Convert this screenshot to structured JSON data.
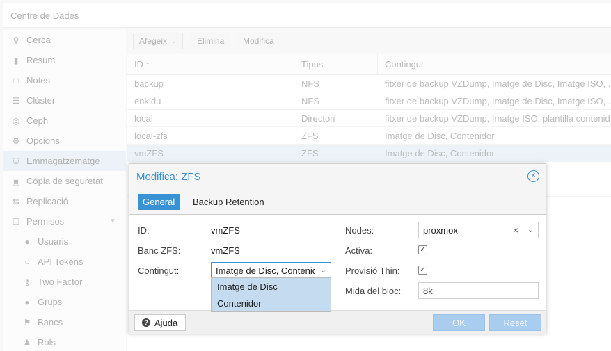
{
  "topbar": {
    "title": "Centre de Dades"
  },
  "sidebar": {
    "items": [
      {
        "label": "Cerca",
        "icon": "search-icon"
      },
      {
        "label": "Resum",
        "icon": "book-icon"
      },
      {
        "label": "Notes",
        "icon": "note-icon"
      },
      {
        "label": "Clúster",
        "icon": "server-icon"
      },
      {
        "label": "Ceph",
        "icon": "ceph-icon"
      },
      {
        "label": "Opcions",
        "icon": "gear-icon"
      },
      {
        "label": "Emmagatzematge",
        "icon": "database-icon"
      },
      {
        "label": "Còpia de seguretat",
        "icon": "floppy-icon"
      },
      {
        "label": "Replicació",
        "icon": "retweet-icon"
      },
      {
        "label": "Permisos",
        "icon": "unlock-icon"
      },
      {
        "label": "Usuaris",
        "icon": "user-icon"
      },
      {
        "label": "API Tokens",
        "icon": "user-outline-icon"
      },
      {
        "label": "Two Factor",
        "icon": "key-icon"
      },
      {
        "label": "Grups",
        "icon": "users-icon"
      },
      {
        "label": "Bancs",
        "icon": "tags-icon"
      },
      {
        "label": "Rols",
        "icon": "male-icon"
      }
    ]
  },
  "toolbar": {
    "add": "Afegeix",
    "remove": "Elimina",
    "edit": "Modifica"
  },
  "grid": {
    "headers": [
      "ID",
      "Tipus",
      "Contingut"
    ],
    "rows": [
      {
        "id": "backup",
        "type": "NFS",
        "content": "fitxer de backup VZDump, Imatge de Disc, Imatge ISO, ..."
      },
      {
        "id": "enkidu",
        "type": "NFS",
        "content": "fitxer de backup VZDump, Imatge de Disc, Imatge ISO, ..."
      },
      {
        "id": "local",
        "type": "Directori",
        "content": "fitxer de backup VZDump, Imatge ISO, plantilla contenid"
      },
      {
        "id": "local-zfs",
        "type": "ZFS",
        "content": "Imatge de Disc, Contenidor"
      },
      {
        "id": "vmZFS",
        "type": "ZFS",
        "content": "Imatge de Disc, Contenidor"
      }
    ]
  },
  "modal": {
    "title": "Modifica: ZFS",
    "tabs": [
      "General",
      "Backup Retention"
    ],
    "fields": {
      "id_label": "ID:",
      "id_value": "vmZFS",
      "pool_label": "Banc ZFS:",
      "pool_value": "vmZFS",
      "content_label": "Contingut:",
      "content_value": "Imatge de Disc, Contenidor",
      "nodes_label": "Nodes:",
      "nodes_value": "proxmox",
      "enable_label": "Activa:",
      "enable_checked": true,
      "thin_label": "Provisió Thin:",
      "thin_checked": true,
      "blocksize_label": "Mida del bloc:",
      "blocksize_value": "8k"
    },
    "dropdown_options": [
      "Imatge de Disc",
      "Contenidor"
    ],
    "help": "Ajuda",
    "ok": "OK",
    "reset": "Reset"
  },
  "colors": {
    "accent": "#3892d4",
    "selection": "#c5dcf0",
    "disabled_button": "#a9cdef"
  }
}
